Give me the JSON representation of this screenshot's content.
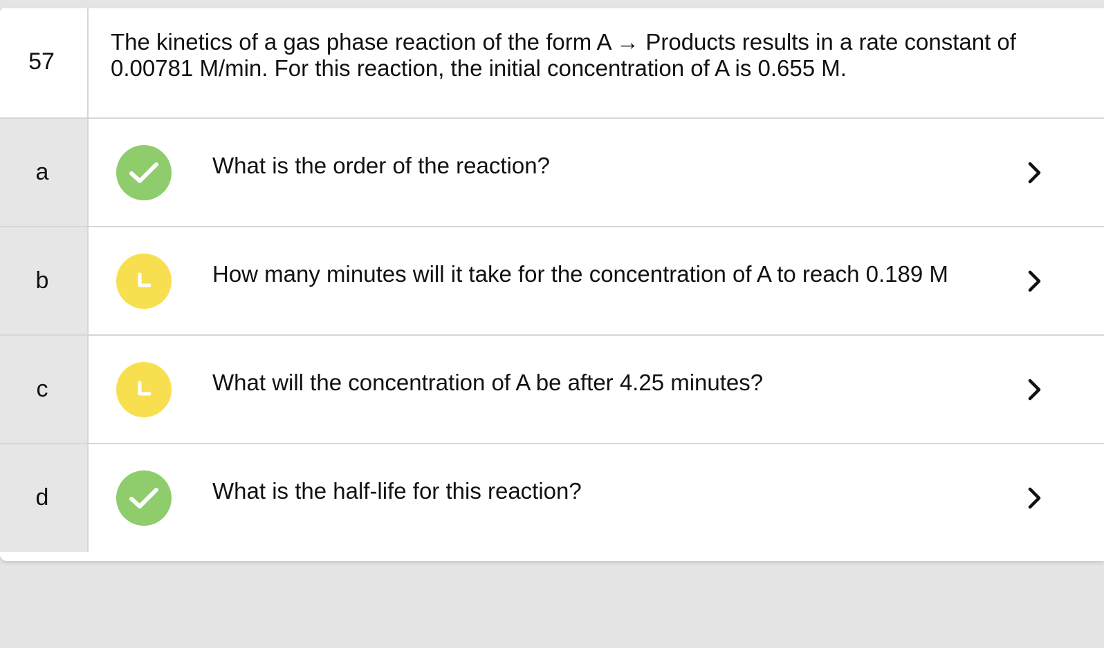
{
  "colors": {
    "complete": "#8fcc6b",
    "in_progress": "#f8df4f"
  },
  "question": {
    "number": "57",
    "prompt": "The kinetics of a gas phase reaction of the form A → Products results in a rate constant of 0.00781 M/min. For this reaction, the initial concentration of A is 0.655 M."
  },
  "parts": [
    {
      "letter": "a",
      "status": "complete",
      "status_icon": "checkmark-icon",
      "text": "What is the order of the reaction?"
    },
    {
      "letter": "b",
      "status": "in-progress",
      "status_icon": "clock-icon",
      "text": "How many minutes will it take for the concentration of A to reach 0.189 M"
    },
    {
      "letter": "c",
      "status": "in-progress",
      "status_icon": "clock-icon",
      "text": "What will the concentration of A be after 4.25 minutes?"
    },
    {
      "letter": "d",
      "status": "complete",
      "status_icon": "checkmark-icon",
      "text": "What is the half-life for this reaction?"
    }
  ]
}
